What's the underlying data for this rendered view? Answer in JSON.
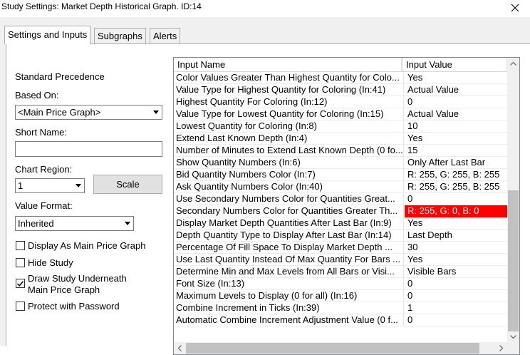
{
  "window": {
    "title": "Study Settings: Market Depth Historical Graph. ID:14"
  },
  "tabs": [
    {
      "label": "Settings and Inputs"
    },
    {
      "label": "Subgraphs"
    },
    {
      "label": "Alerts"
    }
  ],
  "left": {
    "standard_precedence": "Standard Precedence",
    "based_on_label": "Based On:",
    "based_on_value": "<Main Price Graph>",
    "short_name_label": "Short Name:",
    "short_name_value": "",
    "chart_region_label": "Chart Region:",
    "chart_region_value": "1",
    "scale_button": "Scale",
    "value_format_label": "Value Format:",
    "value_format_value": "Inherited",
    "checkboxes": [
      {
        "label": "Display As Main Price Graph",
        "checked": false
      },
      {
        "label": "Hide Study",
        "checked": false
      },
      {
        "label": "Draw Study Underneath\nMain Price Graph",
        "label_line1": "Draw Study Underneath",
        "label_line2": "Main Price Graph",
        "checked": true
      },
      {
        "label": "Protect with Password",
        "checked": false
      }
    ]
  },
  "grid": {
    "col_name": "Input Name",
    "col_value": "Input Value",
    "rows": [
      {
        "name": "Color Values Greater Than Highest Quantity for Colo...",
        "value": "Yes"
      },
      {
        "name": "Value Type for Highest Quantity for Coloring  (In:41)",
        "value": "Actual Value"
      },
      {
        "name": "Highest Quantity For Coloring  (In:12)",
        "value": "0"
      },
      {
        "name": "Value Type for Lowest Quantity for Coloring  (In:15)",
        "value": "Actual Value"
      },
      {
        "name": "Lowest Quantity for Coloring  (In:8)",
        "value": "10"
      },
      {
        "name": "Extend Last Known Depth  (In:4)",
        "value": "Yes"
      },
      {
        "name": "Number of Minutes to Extend Last Known Depth (0 fo...",
        "value": "15"
      },
      {
        "name": "Show Quantity Numbers  (In:6)",
        "value": "Only After Last Bar"
      },
      {
        "name": "Bid Quantity Numbers Color  (In:7)",
        "value": "R: 255, G: 255, B: 255"
      },
      {
        "name": "Ask Quantity Numbers Color  (In:40)",
        "value": "R: 255, G: 255, B: 255"
      },
      {
        "name": "Use Secondary Numbers Color for Quantities Great...",
        "value": "0"
      },
      {
        "name": "Secondary Numbers Color for Quantities Greater Th...",
        "value": "R: 255, G: 0, B: 0",
        "highlight": "#ff0000"
      },
      {
        "name": "Display Market Depth Quantities After Last Bar  (In:9)",
        "value": "Yes"
      },
      {
        "name": "Depth Quantity Type to Display After Last Bar  (In:14)",
        "value": "Last Depth"
      },
      {
        "name": "Percentage Of Fill Space To Display Market Depth ...",
        "value": "30"
      },
      {
        "name": "Use Last Quantity Instead Of Max Quantity For Bars ...",
        "value": "Yes"
      },
      {
        "name": "Determine Min and Max Levels from All Bars or Visi...",
        "value": "Visible Bars"
      },
      {
        "name": "Font Size  (In:13)",
        "value": "0"
      },
      {
        "name": "Maximum Levels to Display (0 for all)  (In:16)",
        "value": "0"
      },
      {
        "name": "Combine Increment in Ticks  (In:39)",
        "value": "1"
      },
      {
        "name": "Automatic Combine Increment Adjustment Value (0 f...",
        "value": "0"
      }
    ]
  },
  "colors": {
    "highlight_red": "#ff0000",
    "panel_bg": "#f0f0f0",
    "scroll_thumb": "#c1c1c1"
  },
  "icons": {
    "close": "close-icon",
    "dropdown": "chevron-down-icon",
    "check": "checkmark-icon",
    "scroll_up": "scroll-up-arrow-icon",
    "scroll_down": "scroll-down-arrow-icon",
    "scroll_left": "scroll-left-arrow-icon",
    "scroll_right": "scroll-right-arrow-icon"
  }
}
